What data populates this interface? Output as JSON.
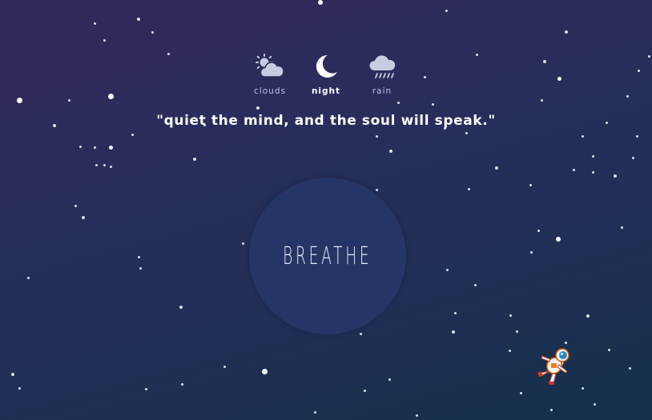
{
  "modes": [
    {
      "label": "clouds",
      "icon": "cloud-sun-icon",
      "active": false
    },
    {
      "label": "night",
      "icon": "moon-icon",
      "active": true
    },
    {
      "label": "rain",
      "icon": "rain-cloud-icon",
      "active": false
    }
  ],
  "quote": "\"quiet the mind, and the soul will speak.\"",
  "breathe_label": "BREATHE",
  "colors": {
    "icon_inactive": "#c9cbe0",
    "icon_active": "#ffffff",
    "circle": "#253565",
    "background_top": "#33285a",
    "background_bottom": "#14304a"
  }
}
